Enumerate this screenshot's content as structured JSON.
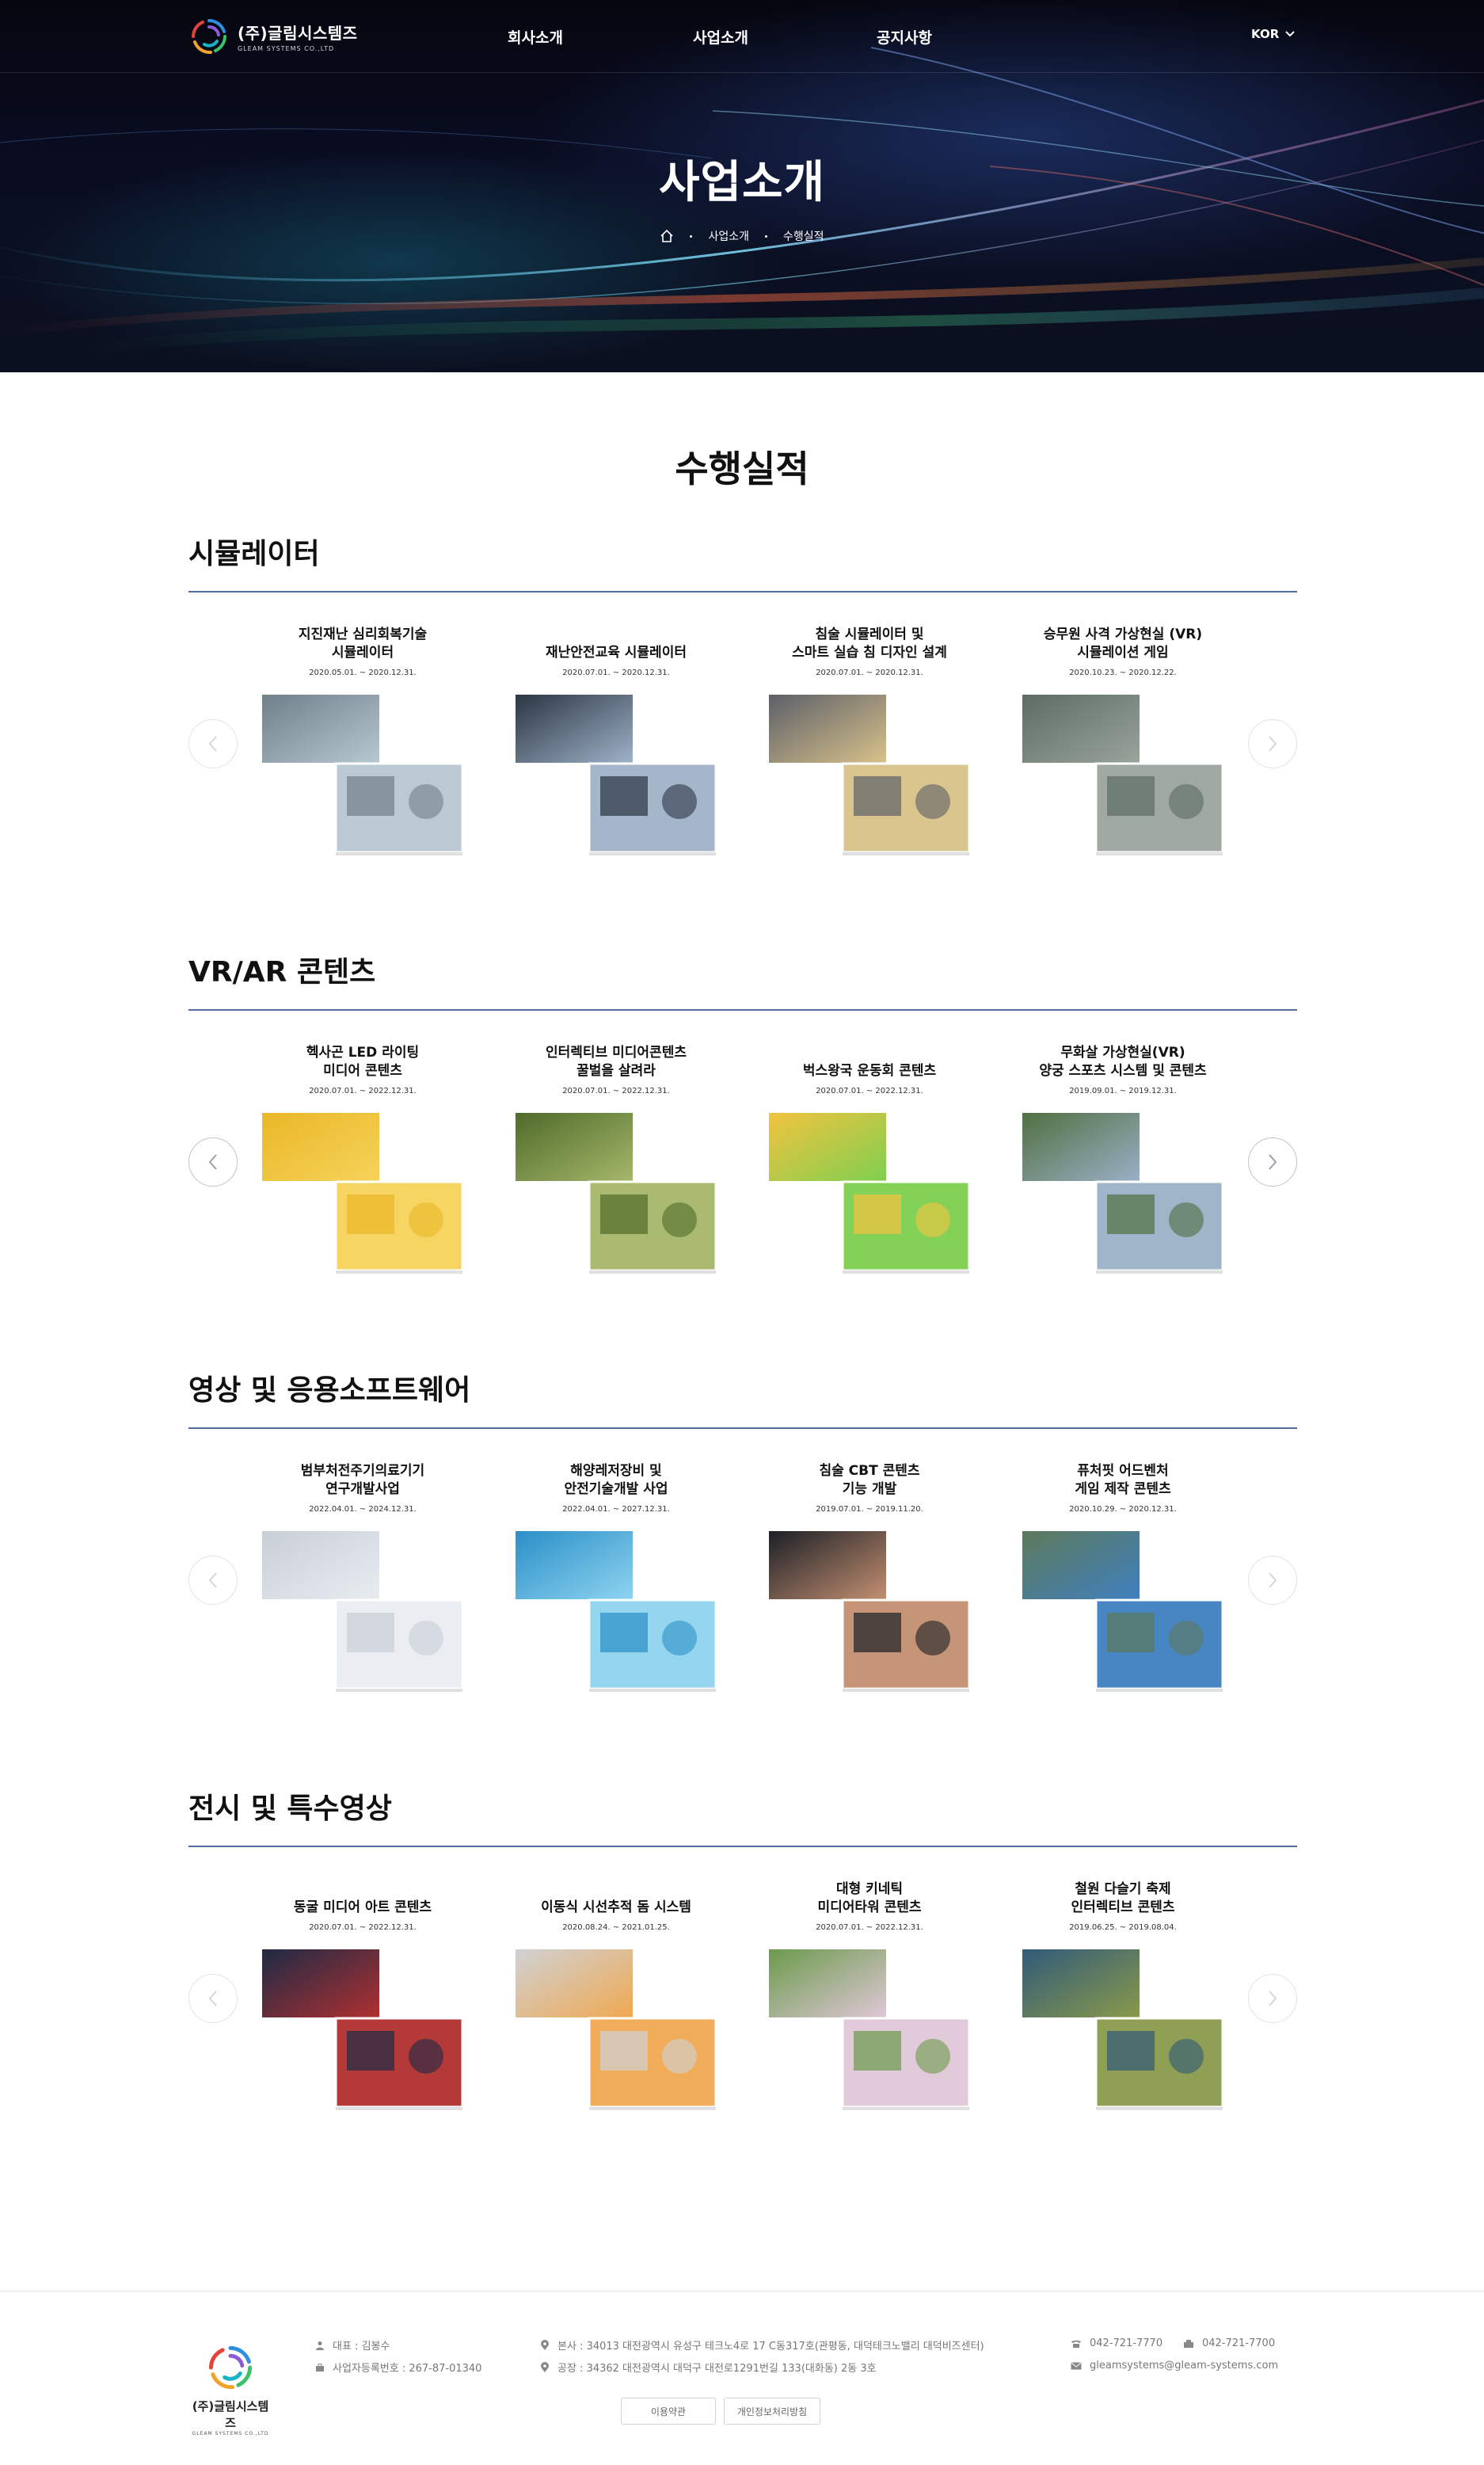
{
  "header": {
    "logo_ko": "(주)글림시스템즈",
    "logo_en": "GLEAM SYSTEMS CO.,LTD",
    "nav": [
      "회사소개",
      "사업소개",
      "공지사항"
    ],
    "lang": "KOR"
  },
  "hero": {
    "title": "사업소개",
    "breadcrumb": [
      "사업소개",
      "수행실적"
    ]
  },
  "page_title": "수행실적",
  "sections": [
    {
      "title": "시뮬레이터",
      "items": [
        {
          "title": "지진재난 심리회복기술\n시뮬레이터",
          "date": "2020.05.01. ~ 2020.12.31."
        },
        {
          "title": "재난안전교육 시뮬레이터",
          "date": "2020.07.01. ~ 2020.12.31."
        },
        {
          "title": "침술 시뮬레이터 및\n스마트 실습 침 디자인 설계",
          "date": "2020.07.01. ~ 2020.12.31."
        },
        {
          "title": "승무원 사격 가상현실 (VR)\n시뮬레이션 게임",
          "date": "2020.10.23. ~ 2020.12.22."
        }
      ]
    },
    {
      "title": "VR/AR 콘텐츠",
      "items": [
        {
          "title": "헥사곤 LED 라이팅\n미디어 콘텐츠",
          "date": "2020.07.01. ~ 2022.12.31."
        },
        {
          "title": "인터렉티브 미디어콘텐츠\n꿀벌을 살려라",
          "date": "2020.07.01. ~ 2022.12.31."
        },
        {
          "title": "벅스왕국 운동회 콘텐츠",
          "date": "2020.07.01. ~ 2022.12.31."
        },
        {
          "title": "무화살 가상현실(VR)\n양궁 스포츠 시스템 및 콘텐츠",
          "date": "2019.09.01. ~ 2019.12.31."
        }
      ]
    },
    {
      "title": "영상 및 응용소프트웨어",
      "items": [
        {
          "title": "범부처전주기의료기기\n연구개발사업",
          "date": "2022.04.01. ~ 2024.12.31."
        },
        {
          "title": "해양레저장비 및\n안전기술개발 사업",
          "date": "2022.04.01. ~ 2027.12.31."
        },
        {
          "title": "침술 CBT 콘텐츠\n기능 개발",
          "date": "2019.07.01. ~ 2019.11.20."
        },
        {
          "title": "퓨처핏 어드벤처\n게임 제작 콘텐츠",
          "date": "2020.10.29. ~ 2020.12.31."
        }
      ]
    },
    {
      "title": "전시 및 특수영상",
      "items": [
        {
          "title": "동굴 미디어 아트 콘텐츠",
          "date": "2020.07.01. ~ 2022.12.31."
        },
        {
          "title": "이동식 시선추적 돔 시스템",
          "date": "2020.08.24. ~ 2021.01.25."
        },
        {
          "title": "대형 키네틱\n미디어타워 콘텐츠",
          "date": "2020.07.01. ~ 2022.12.31."
        },
        {
          "title": "철원 다슬기 축제\n인터렉티브 콘텐츠",
          "date": "2019.06.25. ~ 2019.08.04."
        }
      ]
    }
  ],
  "footer": {
    "logo_ko": "(주)글림시스템즈",
    "logo_en": "GLEAM SYSTEMS CO.,LTD",
    "ceo": "대표 : 김봉수",
    "biz_no": "사업자등록번호 : 267-87-01340",
    "hq": "본사 : 34013 대전광역시 유성구 테크노4로 17 C동317호(관평동, 대덕테크노밸리 대덕비즈센터)",
    "factory": "공장 : 34362 대전광역시 대덕구 대전로1291번길 133(대화동) 2동 3호",
    "tel": "042-721-7770",
    "fax": "042-721-7700",
    "email": "gleamsystems@gleam-systems.com",
    "terms": "이용약관",
    "privacy": "개인정보처리방침"
  },
  "colors": {
    "accent_line": "#51709a",
    "hero_bg": "#0a0d22"
  }
}
